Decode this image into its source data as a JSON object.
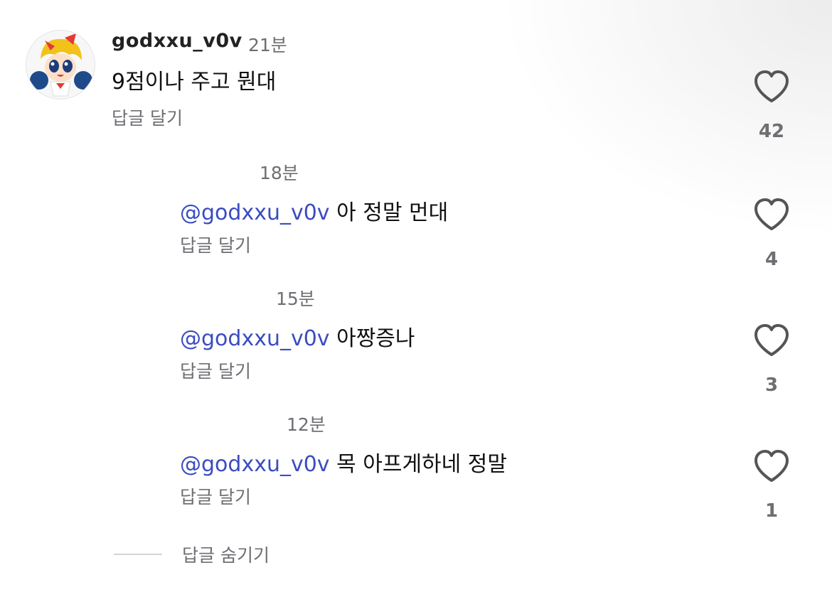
{
  "comment": {
    "username": "godxxu_v0v",
    "time": "21분",
    "text": "9점이나 주고 뭔대",
    "reply_label": "답글 달기",
    "likes": "42",
    "avatar_icon": "cartoon-character-avatar"
  },
  "replies": [
    {
      "time": "18분",
      "mention": "@godxxu_v0v",
      "text": "아 정말 먼대",
      "reply_label": "답글 달기",
      "likes": "4"
    },
    {
      "time": "15분",
      "mention": "@godxxu_v0v",
      "text": "아짱증나",
      "reply_label": "답글 달기",
      "likes": "3"
    },
    {
      "time": "12분",
      "mention": "@godxxu_v0v",
      "text": "목 아프게하네 정말",
      "reply_label": "답글 달기",
      "likes": "1"
    }
  ],
  "hide_replies_label": "답글 숨기기",
  "colors": {
    "mention": "#3b4cc0",
    "secondary_text": "#6e6e73",
    "heart_outline": "#555555"
  }
}
